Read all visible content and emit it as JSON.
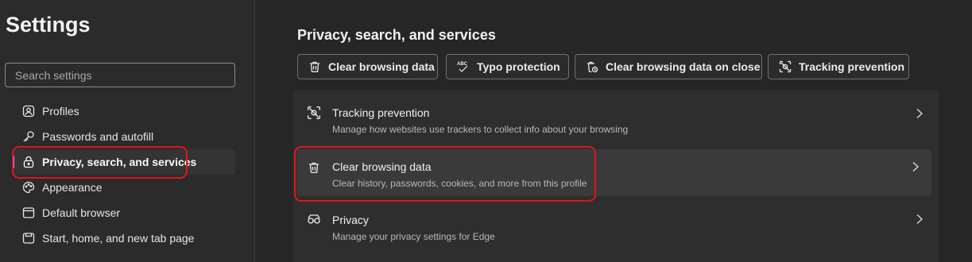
{
  "sidebar": {
    "title": "Settings",
    "search_placeholder": "Search settings",
    "items": [
      {
        "label": "Profiles",
        "icon": "profile-icon"
      },
      {
        "label": "Passwords and autofill",
        "icon": "key-icon"
      },
      {
        "label": "Privacy, search, and services",
        "icon": "lock-icon",
        "active": true
      },
      {
        "label": "Appearance",
        "icon": "palette-icon"
      },
      {
        "label": "Default browser",
        "icon": "browser-icon"
      },
      {
        "label": "Start, home, and new tab page",
        "icon": "home-icon"
      }
    ]
  },
  "main": {
    "title": "Privacy, search, and services",
    "quick_links": [
      {
        "label": "Clear browsing data",
        "icon": "trash-icon"
      },
      {
        "label": "Typo protection",
        "icon": "spellcheck-icon"
      },
      {
        "label": "Clear browsing data on close",
        "icon": "trash-clock-icon"
      },
      {
        "label": "Tracking prevention",
        "icon": "tracking-icon"
      }
    ],
    "rows": [
      {
        "title": "Tracking prevention",
        "desc": "Manage how websites use trackers to collect info about your browsing",
        "icon": "tracking-icon"
      },
      {
        "title": "Clear browsing data",
        "desc": "Clear history, passwords, cookies, and more from this profile",
        "icon": "trash-icon"
      },
      {
        "title": "Privacy",
        "desc": "Manage your privacy settings for Edge",
        "icon": "glasses-icon"
      }
    ]
  },
  "colors": {
    "highlight": "#e0141e",
    "accent": "#b59be8",
    "background": "#262626",
    "sidebar": "#2b2b2b"
  }
}
